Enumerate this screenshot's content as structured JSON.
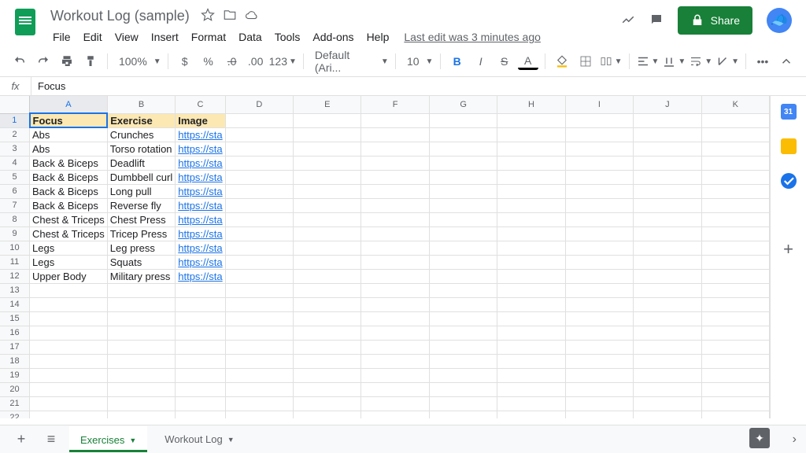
{
  "doc": {
    "title": "Workout Log (sample)"
  },
  "menu": [
    "File",
    "Edit",
    "View",
    "Insert",
    "Format",
    "Data",
    "Tools",
    "Add-ons",
    "Help"
  ],
  "last_edit": "Last edit was 3 minutes ago",
  "share": "Share",
  "toolbar": {
    "zoom": "100%",
    "currency": "$",
    "percent": "%",
    "dec_dec": ".0",
    "inc_dec": ".00",
    "numfmt": "123",
    "font": "Default (Ari...",
    "size": "10",
    "bold": "B",
    "italic": "I",
    "strike": "S",
    "underline_a": "A",
    "more": "•••"
  },
  "fx": {
    "label": "fx",
    "value": "Focus"
  },
  "columns": [
    "A",
    "B",
    "C",
    "D",
    "E",
    "F",
    "G",
    "H",
    "I",
    "J",
    "K"
  ],
  "rows": [
    1,
    2,
    3,
    4,
    5,
    6,
    7,
    8,
    9,
    10,
    11,
    12,
    13,
    14,
    15,
    16,
    17,
    18,
    19,
    20,
    21,
    22
  ],
  "headers": {
    "a": "Focus",
    "b": "Exercise",
    "c": "Image"
  },
  "data": [
    {
      "a": "Abs",
      "b": "Crunches",
      "c": "https://sta"
    },
    {
      "a": "Abs",
      "b": "Torso rotation",
      "c": "https://sta"
    },
    {
      "a": "Back & Biceps",
      "b": "Deadlift",
      "c": "https://sta"
    },
    {
      "a": "Back & Biceps",
      "b": "Dumbbell curl",
      "c": "https://sta"
    },
    {
      "a": "Back & Biceps",
      "b": "Long pull",
      "c": "https://sta"
    },
    {
      "a": "Back & Biceps",
      "b": "Reverse fly",
      "c": "https://sta"
    },
    {
      "a": "Chest & Triceps",
      "b": "Chest Press",
      "c": "https://sta"
    },
    {
      "a": "Chest & Triceps",
      "b": "Tricep Press",
      "c": "https://sta"
    },
    {
      "a": "Legs",
      "b": "Leg press",
      "c": "https://sta"
    },
    {
      "a": "Legs",
      "b": "Squats",
      "c": "https://sta"
    },
    {
      "a": "Upper Body",
      "b": "Military press",
      "c": "https://sta"
    }
  ],
  "tabs": {
    "active": "Exercises",
    "other": "Workout Log"
  },
  "side_cal": "31"
}
